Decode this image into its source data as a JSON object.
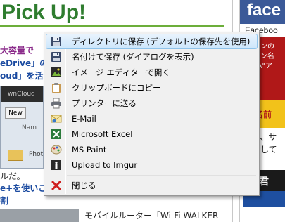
{
  "background_page": {
    "heading": "Pick Up!",
    "facebook_logo": "face",
    "facebook_label": "Faceboo",
    "left_lines": [
      "大容量で",
      "eDrive」の",
      "oud」を活用"
    ],
    "thumb_bar_text": "wnCloud",
    "thumb_button": "New",
    "thumb_col": "Nam",
    "thumb_photo": "Phot",
    "left_text1": "ルだ。",
    "left_text2": "e+を使いこ",
    "left_text3": "割",
    "right_ad_lines": [
      "メインの",
      "メイン名",
      "Q&A\"ア",
      "お名前"
    ],
    "right_text1": "イン、サ",
    "right_text2": "検索して",
    "right_ad_black": "で君",
    "news_text": "モバイルルーター「Wi-Fi WALKER"
  },
  "context_menu": {
    "items": [
      {
        "label": "ディレクトリに保存 (デフォルトの保存先を使用)",
        "icon": "floppy-disk-icon",
        "highlighted": true
      },
      {
        "label": "名付けて保存 (ダイアログを表示)",
        "icon": "floppy-disk-icon"
      },
      {
        "label": "イメージ エディターで開く",
        "icon": "image-editor-icon"
      },
      {
        "label": "クリップボードにコピー",
        "icon": "clipboard-icon"
      },
      {
        "label": "プリンターに送る",
        "icon": "printer-icon"
      },
      {
        "label": "E-Mail",
        "icon": "email-icon"
      },
      {
        "label": "Microsoft Excel",
        "icon": "excel-icon"
      },
      {
        "label": "MS Paint",
        "icon": "paint-icon"
      },
      {
        "label": "Upload to Imgur",
        "icon": "imgur-icon"
      },
      {
        "label": "閉じる",
        "icon": "close-icon"
      }
    ]
  },
  "colors": {
    "highlight": "#cde6fb",
    "menu_bg": "#f0f0f0",
    "heading_green": "#2f7d2f",
    "facebook_blue": "#3b5998"
  }
}
